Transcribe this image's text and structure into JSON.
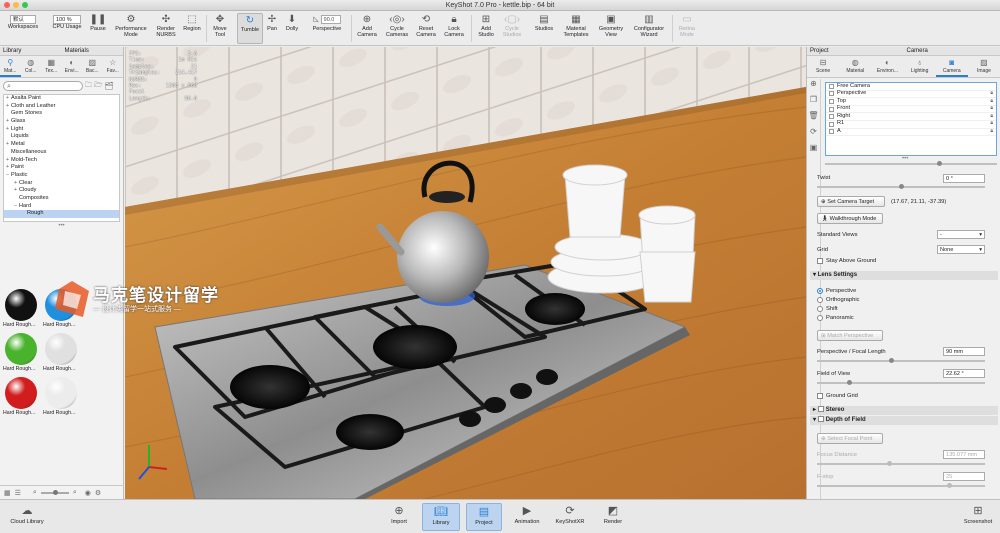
{
  "window": {
    "title": "KeyShot 7.0 Pro  - kettle.bip  - 64 bit"
  },
  "toolbar": {
    "workspace_select": "默认",
    "workspaces": "Workspaces",
    "cpu_select": "100 %",
    "cpu_usage": "CPU Usage",
    "pause": "Pause",
    "performance_mode": "Performance Mode",
    "render_nurbs": "Render NURBS",
    "region": "Region",
    "move_tool": "Move Tool",
    "tumble": "Tumble",
    "pan": "Pan",
    "dolly": "Dolly",
    "perspective_value": "90.0",
    "perspective": "Perspective",
    "add_camera": "Add Camera",
    "cycle_cameras": "Cycle Cameras",
    "reset_camera": "Reset Camera",
    "lock_camera": "Lock Camera",
    "add_studio": "Add Studio",
    "cycle_studios": "Cycle Studios",
    "studios": "Studios",
    "material_templates": "Material Templates",
    "geometry_view": "Geometry View",
    "configurator_wizard": "Configurator Wizard",
    "retina_mode": "Retina Mode"
  },
  "library": {
    "headers": [
      "Library",
      "Materials"
    ],
    "tabs": [
      "Mat...",
      "Col...",
      "Tex...",
      "Envi...",
      "Bac...",
      "Fav..."
    ],
    "search_placeholder": "",
    "tree": [
      {
        "exp": "+",
        "label": "Axalta Paint",
        "indent": 0
      },
      {
        "exp": "+",
        "label": "Cloth and Leather",
        "indent": 0
      },
      {
        "exp": "",
        "label": "Gem Stones",
        "indent": 0
      },
      {
        "exp": "+",
        "label": "Glass",
        "indent": 0
      },
      {
        "exp": "+",
        "label": "Light",
        "indent": 0
      },
      {
        "exp": "",
        "label": "Liquids",
        "indent": 0
      },
      {
        "exp": "+",
        "label": "Metal",
        "indent": 0
      },
      {
        "exp": "",
        "label": "Miscellaneous",
        "indent": 0
      },
      {
        "exp": "+",
        "label": "Mold-Tech",
        "indent": 0
      },
      {
        "exp": "+",
        "label": "Paint",
        "indent": 0
      },
      {
        "exp": "−",
        "label": "Plastic",
        "indent": 0
      },
      {
        "exp": "+",
        "label": "Clear",
        "indent": 1
      },
      {
        "exp": "+",
        "label": "Cloudy",
        "indent": 1
      },
      {
        "exp": "",
        "label": "Composites",
        "indent": 1
      },
      {
        "exp": "−",
        "label": "Hard",
        "indent": 1
      },
      {
        "exp": "",
        "label": "Rough",
        "indent": 2
      }
    ],
    "thumbnails": [
      {
        "label": "Hard Rough...",
        "color": "#111111"
      },
      {
        "label": "Hard Rough...",
        "color": "#1f8fe0"
      },
      {
        "label": "Hard Rough...",
        "color": "#4ab32d"
      },
      {
        "label": "Hard Rough...",
        "color": "#e0e0e0"
      },
      {
        "label": "Hard Rough...",
        "color": "#d11d1d"
      },
      {
        "label": "Hard Rough...",
        "color": "#ececec"
      }
    ]
  },
  "watermark": {
    "title": "马克笔设计留学",
    "subtitle": "— 设计类留学一站式服务 —"
  },
  "stats": [
    {
      "k": "FPS:",
      "v": "3.6"
    },
    {
      "k": "Time:",
      "v": "1m 01s"
    },
    {
      "k": "Samples:",
      "v": "21"
    },
    {
      "k": "Triangles:",
      "v": "214,417"
    },
    {
      "k": "NURBS:",
      "v": "9"
    },
    {
      "k": "Res:",
      "v": "1300 x 868"
    },
    {
      "k": "Focal Length:",
      "v": "90.0"
    }
  ],
  "project": {
    "headers": [
      "Project",
      "Camera"
    ],
    "tabs": [
      "Scene",
      "Material",
      "Environ...",
      "Lighting",
      "Camera",
      "Image"
    ],
    "cameras": [
      "Free Camera",
      "Perspective",
      "Top",
      "Front",
      "Right",
      "R1",
      "A"
    ],
    "twist_label": "Twist",
    "twist_value": "0 °",
    "set_target": "Set Camera Target",
    "target_coords": "(17.67, 21.11, -37.39)",
    "walkthrough": "Walkthrough Mode",
    "standard_views": "Standard Views",
    "standard_views_value": "-",
    "grid": "Grid",
    "grid_value": "None",
    "stay_above": "Stay Above Ground",
    "lens_settings": "Lens Settings",
    "lens_options": [
      "Perspective",
      "Orthographic",
      "Shift",
      "Panoramic"
    ],
    "match_perspective": "Match Perspective",
    "focal_label": "Perspective / Focal Length",
    "focal_value": "90 mm",
    "fov_label": "Field of View",
    "fov_value": "22.62 °",
    "ground_grid": "Ground Grid",
    "stereo": "Stereo",
    "dof": "Depth of Field",
    "select_focal": "Select Focal Point",
    "focus_distance": "Focus Distance",
    "focus_value": "135.077 mm",
    "fstop": "F-stop",
    "fstop_value": "25"
  },
  "bottom": {
    "cloud_library": "Cloud Library",
    "import": "Import",
    "library": "Library",
    "project": "Project",
    "animation": "Animation",
    "keyshotxr": "KeyShotXR",
    "render": "Render",
    "screenshot": "Screenshot"
  }
}
